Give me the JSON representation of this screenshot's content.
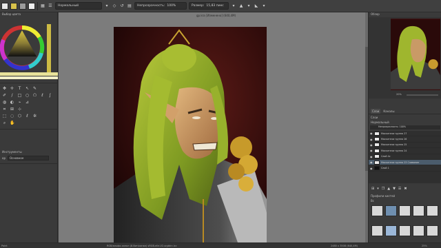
{
  "toolbar": {
    "blend_mode": "Нормальный",
    "opacity_label": "Непрозрачность:",
    "opacity_value": "100%",
    "size_label": "Размер:",
    "size_value": "15,83 пикс"
  },
  "left_dock": {
    "selector_title": "Выбор цвета",
    "tool_options_title": "Инструменты",
    "blend_label": "ор",
    "blend_value": "Основное",
    "footer": "Paint"
  },
  "canvas": {
    "document_title": "gp.kra [Изменено] (640,4М)"
  },
  "overview": {
    "title": "Обзор",
    "zoom": "20%"
  },
  "layers": {
    "tabs": [
      "Слои",
      "Каналы"
    ],
    "panel_label": "Слои",
    "blend": "Нормальный",
    "opacity": "Непрозрачность: 100%",
    "items": [
      "Маскители группа 27",
      "Маскители группа 26",
      "Маскители группа 25",
      "Маскители группа 24",
      "Слой 4с",
      "Маскители группа 23 Сливание",
      "Слой 1"
    ]
  },
  "brush_presets": {
    "title": "Профили кистей",
    "tag": "Вс"
  },
  "status": {
    "mode": "Paint",
    "colorspace": "RGB/альфа-канал (8-бит/канал) sRGB-elle-V2-srgbtrc.icc",
    "dimensions": "2480 x 3508 (640,4M)",
    "zoom": "25%"
  },
  "colors": {
    "background": "#3c3c3c",
    "canvas_bg": "#7c7c7c",
    "selection": "#4b5c6c"
  }
}
